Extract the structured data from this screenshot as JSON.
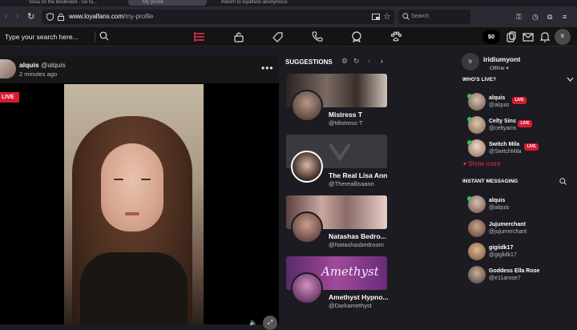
{
  "browser": {
    "tabs": [
      {
        "label": "Sosa on the boulevard - Go to...",
        "active": false
      },
      {
        "label": "My profile",
        "active": true
      },
      {
        "label": "Return to loyalfans anonymous",
        "active": false
      }
    ],
    "url_host": "www.loyalfans.com",
    "url_path": "/my-profile",
    "search_placeholder": "Search"
  },
  "site_header": {
    "search_placeholder": "Type your search here...",
    "balance": "$0",
    "user_initials": "Ir",
    "nav_icons": [
      "feed-icon",
      "unlock-icon",
      "tag-icon",
      "phone-icon",
      "badge-icon",
      "paw-icon"
    ],
    "right_icons": [
      "wallet-icon",
      "mail-icon",
      "bell-icon"
    ]
  },
  "post": {
    "name": "alquis",
    "handle": "@alquis",
    "time": "2 minutes ago",
    "live_label": "LIVE",
    "menu": "•••"
  },
  "suggestions": {
    "title": "SUGGESTIONS",
    "cards": [
      {
        "name": "Mistress T",
        "handle": "@Mistress-T"
      },
      {
        "name": "The Real Lisa Ann",
        "handle": "@Thereallisaann"
      },
      {
        "name": "Natashas Bedro...",
        "handle": "@Natashasbedroom"
      },
      {
        "name": "Amethyst Hypno...",
        "handle": "@Darkamethyst",
        "banner_text": "Amethyst"
      }
    ]
  },
  "sidebar": {
    "user_initials": "Ir",
    "user_name": "iridiumyont",
    "status": "Offline",
    "whos_live_title": "WHO'S LIVE?",
    "live_users": [
      {
        "name": "alquis",
        "handle": "@alquis",
        "badge": "LIVE"
      },
      {
        "name": "Celty Sins",
        "handle": "@celtyains",
        "badge": "LIVE"
      },
      {
        "name": "Switch Mila",
        "handle": "@SwitchMila",
        "badge": "LIVE"
      }
    ],
    "show_more": "Show more",
    "messaging_title": "INSTANT MESSAGING",
    "contacts": [
      {
        "name": "alquis",
        "handle": "@alquis"
      },
      {
        "name": "Jujumerchant",
        "handle": "@jujumerchant"
      },
      {
        "name": "gigiidk17",
        "handle": "@giglidk17"
      },
      {
        "name": "Goddess Ella Rose",
        "handle": "@e11arose7"
      }
    ]
  },
  "colors": {
    "accent_red": "#d81b31",
    "online_green": "#3cbd5a",
    "background": "#1c1b22"
  }
}
